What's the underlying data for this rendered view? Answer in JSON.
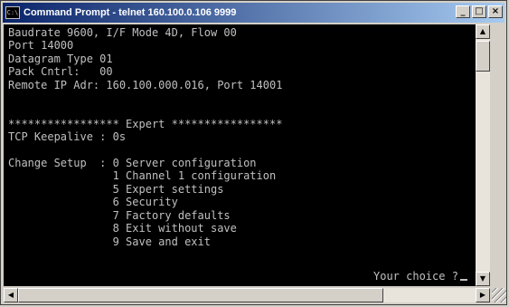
{
  "window": {
    "title": "Command Prompt - telnet 160.100.0.106 9999",
    "icon_text": "C:\\",
    "minimize_glyph": "_",
    "maximize_glyph": "□",
    "close_glyph": "×"
  },
  "console": {
    "lines": [
      "Baudrate 9600, I/F Mode 4D, Flow 00",
      "Port 14000",
      "Datagram Type 01",
      "Pack Cntrl:   00",
      "Remote IP Adr: 160.100.000.016, Port 14001",
      "",
      "",
      "***************** Expert *****************",
      "TCP Keepalive : 0s",
      "",
      "Change Setup  : 0 Server configuration",
      "                1 Channel 1 configuration",
      "                5 Expert settings",
      "                6 Security",
      "                7 Factory defaults",
      "                8 Exit without save",
      "                9 Save and exit"
    ],
    "prompt": "Your choice ?"
  },
  "scrollbar": {
    "up_arrow": "▲",
    "down_arrow": "▼",
    "left_arrow": "◀",
    "right_arrow": "▶"
  },
  "colors": {
    "console_bg": "#000000",
    "console_fg": "#c0c0c0",
    "title_gradient_start": "#0a246a",
    "title_gradient_end": "#a6caf0"
  }
}
